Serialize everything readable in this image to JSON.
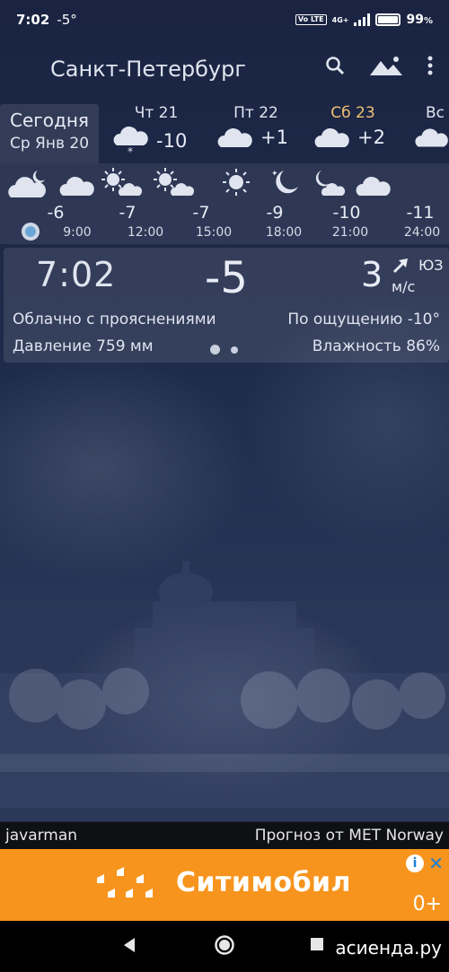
{
  "status": {
    "time": "7:02",
    "temp": "-5°",
    "battery": "99",
    "battery_pct": 99,
    "battery_unit": "%",
    "volte": "Vo LTE",
    "network": "4G+"
  },
  "app": {
    "city": "Санкт-Петербург",
    "icons": [
      "search-icon",
      "landscape-icon",
      "more-vert-icon"
    ]
  },
  "days": {
    "today": {
      "label": "Сегодня",
      "date": "Ср Янв 20"
    },
    "forecast": [
      {
        "name": "Чт 21",
        "temp": "-10",
        "icon": "snow-cloud-icon"
      },
      {
        "name": "Пт 22",
        "temp": "+1",
        "icon": "cloud-icon"
      },
      {
        "name": "Сб 23",
        "temp": "+2",
        "icon": "cloud-icon",
        "accent": "#f0c070"
      },
      {
        "name": "Вс",
        "temp": "",
        "icon": "cloud-icon"
      }
    ]
  },
  "hourly": {
    "temps": [
      "-6",
      "-7",
      "-7",
      "-9",
      "-10",
      "-11"
    ],
    "times": [
      "9:00",
      "12:00",
      "15:00",
      "18:00",
      "21:00",
      "24:00"
    ]
  },
  "current": {
    "time": "7:02",
    "temp": "-5",
    "wind_speed": "3",
    "wind_dir": "ЮЗ",
    "wind_unit": "м/с",
    "description": "Облачно с прояснениями",
    "feels_like": "По ощущению -10°",
    "pressure": "Давление 759 мм",
    "humidity": "Влажность 86%"
  },
  "footer": {
    "author": "javarman",
    "source": "Прогноз от MET Norway"
  },
  "ad": {
    "brand": "Ситимобил",
    "age": "0+",
    "info": "i",
    "close": "✕",
    "color": "#f7941d"
  },
  "watermark": "асиенда.ру"
}
